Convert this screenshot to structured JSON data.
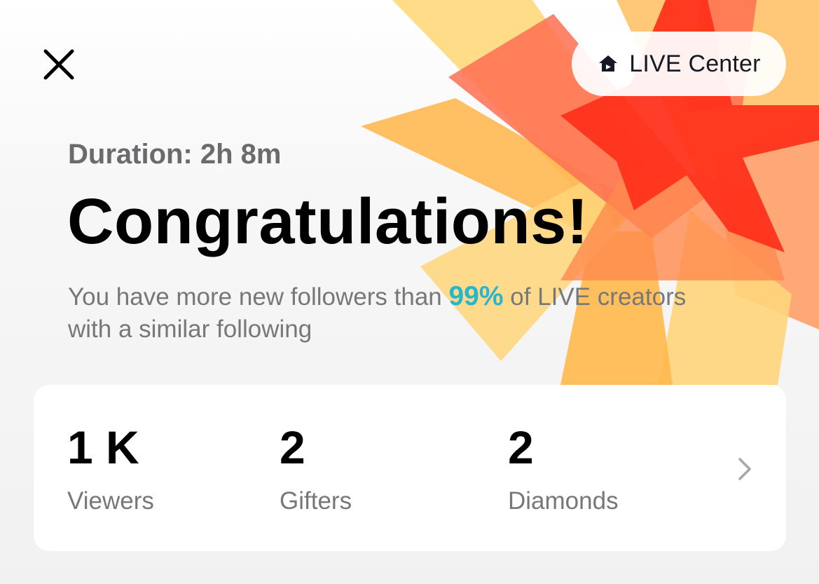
{
  "header": {
    "close_icon": "close-icon",
    "live_center": {
      "icon": "home-icon",
      "label": "LIVE Center"
    }
  },
  "summary": {
    "duration": "Duration: 2h 8m",
    "headline": "Congratulations!",
    "message_before": "You have more new followers than ",
    "highlight": "99%",
    "message_after": " of LIVE creators with a similar following"
  },
  "stats": [
    {
      "value": "1 K",
      "label": "Viewers"
    },
    {
      "value": "2",
      "label": "Gifters"
    },
    {
      "value": "2",
      "label": "Diamonds"
    }
  ],
  "stats_chevron_icon": "chevron-right-icon",
  "colors": {
    "highlight": "#2bb5c9",
    "burst_red": "#ff3a1d",
    "burst_orange": "#ffa13d",
    "burst_yellow": "#ffd97a",
    "burst_coral": "#ff6e52"
  }
}
